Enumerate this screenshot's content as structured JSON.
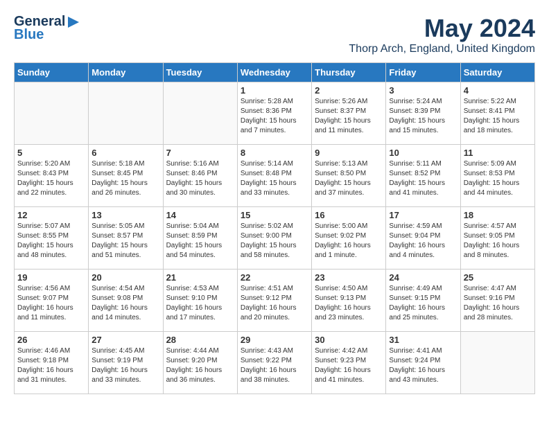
{
  "logo": {
    "text_general": "General",
    "text_blue": "Blue"
  },
  "title": {
    "month_year": "May 2024",
    "location": "Thorp Arch, England, United Kingdom"
  },
  "days_of_week": [
    "Sunday",
    "Monday",
    "Tuesday",
    "Wednesday",
    "Thursday",
    "Friday",
    "Saturday"
  ],
  "weeks": [
    [
      {
        "day": "",
        "info": ""
      },
      {
        "day": "",
        "info": ""
      },
      {
        "day": "",
        "info": ""
      },
      {
        "day": "1",
        "info": "Sunrise: 5:28 AM\nSunset: 8:36 PM\nDaylight: 15 hours\nand 7 minutes."
      },
      {
        "day": "2",
        "info": "Sunrise: 5:26 AM\nSunset: 8:37 PM\nDaylight: 15 hours\nand 11 minutes."
      },
      {
        "day": "3",
        "info": "Sunrise: 5:24 AM\nSunset: 8:39 PM\nDaylight: 15 hours\nand 15 minutes."
      },
      {
        "day": "4",
        "info": "Sunrise: 5:22 AM\nSunset: 8:41 PM\nDaylight: 15 hours\nand 18 minutes."
      }
    ],
    [
      {
        "day": "5",
        "info": "Sunrise: 5:20 AM\nSunset: 8:43 PM\nDaylight: 15 hours\nand 22 minutes."
      },
      {
        "day": "6",
        "info": "Sunrise: 5:18 AM\nSunset: 8:45 PM\nDaylight: 15 hours\nand 26 minutes."
      },
      {
        "day": "7",
        "info": "Sunrise: 5:16 AM\nSunset: 8:46 PM\nDaylight: 15 hours\nand 30 minutes."
      },
      {
        "day": "8",
        "info": "Sunrise: 5:14 AM\nSunset: 8:48 PM\nDaylight: 15 hours\nand 33 minutes."
      },
      {
        "day": "9",
        "info": "Sunrise: 5:13 AM\nSunset: 8:50 PM\nDaylight: 15 hours\nand 37 minutes."
      },
      {
        "day": "10",
        "info": "Sunrise: 5:11 AM\nSunset: 8:52 PM\nDaylight: 15 hours\nand 41 minutes."
      },
      {
        "day": "11",
        "info": "Sunrise: 5:09 AM\nSunset: 8:53 PM\nDaylight: 15 hours\nand 44 minutes."
      }
    ],
    [
      {
        "day": "12",
        "info": "Sunrise: 5:07 AM\nSunset: 8:55 PM\nDaylight: 15 hours\nand 48 minutes."
      },
      {
        "day": "13",
        "info": "Sunrise: 5:05 AM\nSunset: 8:57 PM\nDaylight: 15 hours\nand 51 minutes."
      },
      {
        "day": "14",
        "info": "Sunrise: 5:04 AM\nSunset: 8:59 PM\nDaylight: 15 hours\nand 54 minutes."
      },
      {
        "day": "15",
        "info": "Sunrise: 5:02 AM\nSunset: 9:00 PM\nDaylight: 15 hours\nand 58 minutes."
      },
      {
        "day": "16",
        "info": "Sunrise: 5:00 AM\nSunset: 9:02 PM\nDaylight: 16 hours\nand 1 minute."
      },
      {
        "day": "17",
        "info": "Sunrise: 4:59 AM\nSunset: 9:04 PM\nDaylight: 16 hours\nand 4 minutes."
      },
      {
        "day": "18",
        "info": "Sunrise: 4:57 AM\nSunset: 9:05 PM\nDaylight: 16 hours\nand 8 minutes."
      }
    ],
    [
      {
        "day": "19",
        "info": "Sunrise: 4:56 AM\nSunset: 9:07 PM\nDaylight: 16 hours\nand 11 minutes."
      },
      {
        "day": "20",
        "info": "Sunrise: 4:54 AM\nSunset: 9:08 PM\nDaylight: 16 hours\nand 14 minutes."
      },
      {
        "day": "21",
        "info": "Sunrise: 4:53 AM\nSunset: 9:10 PM\nDaylight: 16 hours\nand 17 minutes."
      },
      {
        "day": "22",
        "info": "Sunrise: 4:51 AM\nSunset: 9:12 PM\nDaylight: 16 hours\nand 20 minutes."
      },
      {
        "day": "23",
        "info": "Sunrise: 4:50 AM\nSunset: 9:13 PM\nDaylight: 16 hours\nand 23 minutes."
      },
      {
        "day": "24",
        "info": "Sunrise: 4:49 AM\nSunset: 9:15 PM\nDaylight: 16 hours\nand 25 minutes."
      },
      {
        "day": "25",
        "info": "Sunrise: 4:47 AM\nSunset: 9:16 PM\nDaylight: 16 hours\nand 28 minutes."
      }
    ],
    [
      {
        "day": "26",
        "info": "Sunrise: 4:46 AM\nSunset: 9:18 PM\nDaylight: 16 hours\nand 31 minutes."
      },
      {
        "day": "27",
        "info": "Sunrise: 4:45 AM\nSunset: 9:19 PM\nDaylight: 16 hours\nand 33 minutes."
      },
      {
        "day": "28",
        "info": "Sunrise: 4:44 AM\nSunset: 9:20 PM\nDaylight: 16 hours\nand 36 minutes."
      },
      {
        "day": "29",
        "info": "Sunrise: 4:43 AM\nSunset: 9:22 PM\nDaylight: 16 hours\nand 38 minutes."
      },
      {
        "day": "30",
        "info": "Sunrise: 4:42 AM\nSunset: 9:23 PM\nDaylight: 16 hours\nand 41 minutes."
      },
      {
        "day": "31",
        "info": "Sunrise: 4:41 AM\nSunset: 9:24 PM\nDaylight: 16 hours\nand 43 minutes."
      },
      {
        "day": "",
        "info": ""
      }
    ]
  ]
}
